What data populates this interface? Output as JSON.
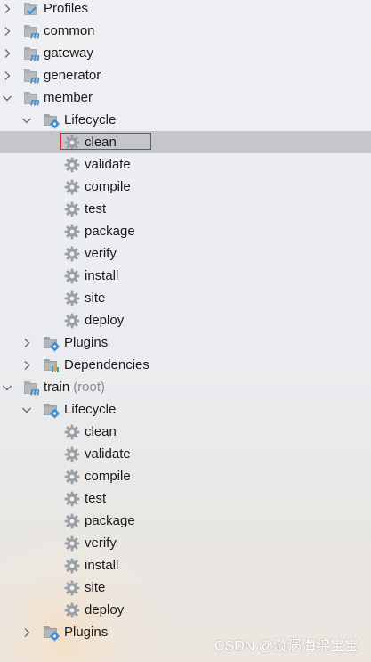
{
  "tree": {
    "items": [
      {
        "label": "Profiles",
        "suffix": "",
        "kind": "profiles",
        "depth": 0,
        "chevron": "right",
        "selected": false
      },
      {
        "label": "common",
        "suffix": "",
        "kind": "module",
        "depth": 0,
        "chevron": "right",
        "selected": false
      },
      {
        "label": "gateway",
        "suffix": "",
        "kind": "module",
        "depth": 0,
        "chevron": "right",
        "selected": false
      },
      {
        "label": "generator",
        "suffix": "",
        "kind": "module",
        "depth": 0,
        "chevron": "right",
        "selected": false
      },
      {
        "label": "member",
        "suffix": "",
        "kind": "module",
        "depth": 0,
        "chevron": "down",
        "selected": false
      },
      {
        "label": "Lifecycle",
        "suffix": "",
        "kind": "folder-gear",
        "depth": 1,
        "chevron": "down",
        "selected": false
      },
      {
        "label": "clean",
        "suffix": "",
        "kind": "goal",
        "depth": 2,
        "chevron": "none",
        "selected": true,
        "highlighted": true
      },
      {
        "label": "validate",
        "suffix": "",
        "kind": "goal",
        "depth": 2,
        "chevron": "none",
        "selected": false
      },
      {
        "label": "compile",
        "suffix": "",
        "kind": "goal",
        "depth": 2,
        "chevron": "none",
        "selected": false
      },
      {
        "label": "test",
        "suffix": "",
        "kind": "goal",
        "depth": 2,
        "chevron": "none",
        "selected": false
      },
      {
        "label": "package",
        "suffix": "",
        "kind": "goal",
        "depth": 2,
        "chevron": "none",
        "selected": false
      },
      {
        "label": "verify",
        "suffix": "",
        "kind": "goal",
        "depth": 2,
        "chevron": "none",
        "selected": false
      },
      {
        "label": "install",
        "suffix": "",
        "kind": "goal",
        "depth": 2,
        "chevron": "none",
        "selected": false
      },
      {
        "label": "site",
        "suffix": "",
        "kind": "goal",
        "depth": 2,
        "chevron": "none",
        "selected": false
      },
      {
        "label": "deploy",
        "suffix": "",
        "kind": "goal",
        "depth": 2,
        "chevron": "none",
        "selected": false
      },
      {
        "label": "Plugins",
        "suffix": "",
        "kind": "folder-gear",
        "depth": 1,
        "chevron": "right",
        "selected": false
      },
      {
        "label": "Dependencies",
        "suffix": "",
        "kind": "folder-bars",
        "depth": 1,
        "chevron": "right",
        "selected": false
      },
      {
        "label": "train",
        "suffix": "(root)",
        "kind": "module",
        "depth": 0,
        "chevron": "down",
        "selected": false
      },
      {
        "label": "Lifecycle",
        "suffix": "",
        "kind": "folder-gear",
        "depth": 1,
        "chevron": "down",
        "selected": false
      },
      {
        "label": "clean",
        "suffix": "",
        "kind": "goal",
        "depth": 2,
        "chevron": "none",
        "selected": false
      },
      {
        "label": "validate",
        "suffix": "",
        "kind": "goal",
        "depth": 2,
        "chevron": "none",
        "selected": false
      },
      {
        "label": "compile",
        "suffix": "",
        "kind": "goal",
        "depth": 2,
        "chevron": "none",
        "selected": false
      },
      {
        "label": "test",
        "suffix": "",
        "kind": "goal",
        "depth": 2,
        "chevron": "none",
        "selected": false
      },
      {
        "label": "package",
        "suffix": "",
        "kind": "goal",
        "depth": 2,
        "chevron": "none",
        "selected": false
      },
      {
        "label": "verify",
        "suffix": "",
        "kind": "goal",
        "depth": 2,
        "chevron": "none",
        "selected": false
      },
      {
        "label": "install",
        "suffix": "",
        "kind": "goal",
        "depth": 2,
        "chevron": "none",
        "selected": false
      },
      {
        "label": "site",
        "suffix": "",
        "kind": "goal",
        "depth": 2,
        "chevron": "none",
        "selected": false
      },
      {
        "label": "deploy",
        "suffix": "",
        "kind": "goal",
        "depth": 2,
        "chevron": "none",
        "selected": false
      },
      {
        "label": "Plugins",
        "suffix": "",
        "kind": "folder-gear",
        "depth": 1,
        "chevron": "right",
        "selected": false
      }
    ]
  },
  "colors": {
    "selected_row": "#c4c6ca",
    "highlight_box": "#e5262b",
    "maven_blue": "#3d8fd1",
    "gear_gray": "#9aa0a6",
    "folder_gray": "#9ea3a8"
  },
  "watermark": {
    "text": "CSDN @漩涡海绵宝宝"
  }
}
